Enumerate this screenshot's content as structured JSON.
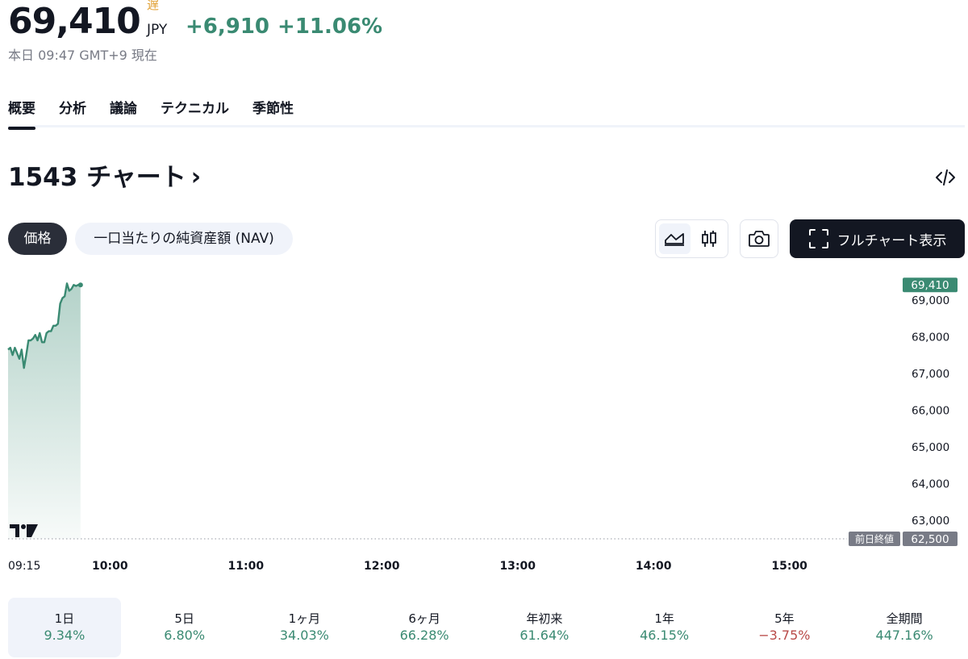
{
  "quote": {
    "price": "69,410",
    "delay_badge": "遅",
    "currency": "JPY",
    "change_abs": "+6,910",
    "change_pct": "+11.06%",
    "timestamp": "本日 09:47 GMT+9 現在"
  },
  "tabs": [
    {
      "label": "概要",
      "active": true
    },
    {
      "label": "分析",
      "active": false
    },
    {
      "label": "議論",
      "active": false
    },
    {
      "label": "テクニカル",
      "active": false
    },
    {
      "label": "季節性",
      "active": false
    }
  ],
  "chart_header": {
    "title": "1543 チャート",
    "chevron": "›"
  },
  "toolbar": {
    "price_pill": "価格",
    "nav_pill": "一口当たりの純資産額 (NAV)",
    "full_chart_label": "フルチャート表示",
    "icons": [
      "code-embed-icon",
      "area-chart-icon",
      "candlestick-icon",
      "camera-icon",
      "fullscreen-icon"
    ]
  },
  "colors": {
    "accent_green": "#3a8a72",
    "negative_red": "#b94a48",
    "dark": "#131722",
    "delay_orange": "#e2a33a"
  },
  "chart_data": {
    "type": "area",
    "x": [
      "09:15",
      "09:16",
      "09:17",
      "09:18",
      "09:19",
      "09:20",
      "09:21",
      "09:22",
      "09:23",
      "09:24",
      "09:25",
      "09:26",
      "09:27",
      "09:28",
      "09:29",
      "09:30",
      "09:31",
      "09:32",
      "09:33",
      "09:34",
      "09:35",
      "09:36",
      "09:37",
      "09:38",
      "09:39",
      "09:40",
      "09:41",
      "09:42",
      "09:43",
      "09:44",
      "09:45",
      "09:46",
      "09:47"
    ],
    "values": [
      67650,
      67700,
      67500,
      67700,
      67550,
      67400,
      67650,
      67150,
      67500,
      67900,
      67900,
      67950,
      68050,
      67900,
      68100,
      67850,
      67850,
      68100,
      68150,
      68150,
      68300,
      68300,
      68350,
      68900,
      69050,
      69100,
      69450,
      69250,
      69300,
      69410,
      69380,
      69410,
      69410
    ],
    "previous_close": 62500,
    "previous_close_label": "前日終値",
    "previous_close_text": "62,500",
    "last_price_text": "69,410",
    "y_ticks": [
      "69,000",
      "68,000",
      "67,000",
      "66,000",
      "65,000",
      "64,000",
      "63,000"
    ],
    "y_tick_values": [
      69000,
      68000,
      67000,
      66000,
      65000,
      64000,
      63000
    ],
    "x_ticks": [
      "09:15",
      "10:00",
      "11:00",
      "12:00",
      "13:00",
      "14:00",
      "15:00"
    ],
    "ylim": [
      62500,
      69700
    ],
    "xlim": [
      "09:15",
      "15:45"
    ],
    "grid": false,
    "logo": "TV"
  },
  "periods": [
    {
      "label": "1日",
      "value": "9.34%",
      "negative": false,
      "active": true
    },
    {
      "label": "5日",
      "value": "6.80%",
      "negative": false,
      "active": false
    },
    {
      "label": "1ヶ月",
      "value": "34.03%",
      "negative": false,
      "active": false
    },
    {
      "label": "6ヶ月",
      "value": "66.28%",
      "negative": false,
      "active": false
    },
    {
      "label": "年初来",
      "value": "61.64%",
      "negative": false,
      "active": false
    },
    {
      "label": "1年",
      "value": "46.15%",
      "negative": false,
      "active": false
    },
    {
      "label": "5年",
      "value": "−3.75%",
      "negative": true,
      "active": false
    },
    {
      "label": "全期間",
      "value": "447.16%",
      "negative": false,
      "active": false
    }
  ]
}
